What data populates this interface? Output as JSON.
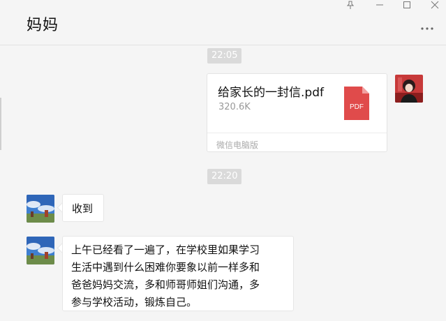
{
  "header": {
    "title": "妈妈"
  },
  "timestamps": [
    "22:05",
    "22:20"
  ],
  "file_message": {
    "name": "给家长的一封信.pdf",
    "size": "320.6K",
    "badge": "PDF",
    "source": "微信电脑版",
    "badge_color": "#e04b4b"
  },
  "messages": [
    {
      "text": "收到"
    },
    {
      "lines": [
        "上午已经看了一遍了，在学校里如果学习",
        "生活中遇到什么困难你要象以前一样多和",
        "爸爸妈妈交流，多和师哥师姐们沟通，多",
        "参与学校活动，锻炼自己。"
      ]
    }
  ],
  "icons": [
    "pin-icon",
    "minimize-icon",
    "maximize-icon",
    "close-icon",
    "more-icon",
    "pdf-file-icon"
  ]
}
